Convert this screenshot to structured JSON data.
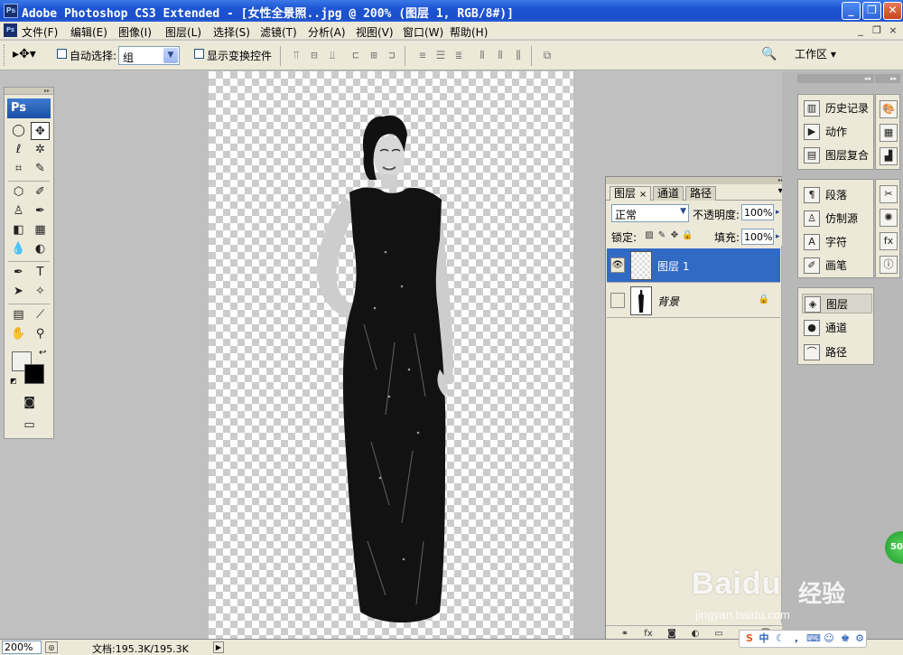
{
  "window": {
    "title": "Adobe Photoshop CS3 Extended - [女性全景照..jpg @ 200% (图层 1, RGB/8#)]",
    "minimize": "_",
    "maximize": "❐",
    "close": "✕"
  },
  "menu": [
    "文件(F)",
    "编辑(E)",
    "图像(I)",
    "图层(L)",
    "选择(S)",
    "滤镜(T)",
    "分析(A)",
    "视图(V)",
    "窗口(W)",
    "帮助(H)"
  ],
  "mdi_controls": [
    "_",
    "❐",
    "×"
  ],
  "options_bar": {
    "auto_select_label": "自动选择:",
    "auto_select_value": "组",
    "show_transform_label": "显示变换控件",
    "workspace_label": "工作区 ▾"
  },
  "toolbox": {
    "logo": "Ps"
  },
  "layers_panel": {
    "tabs": [
      "图层",
      "通道",
      "路径"
    ],
    "tab_close": "×",
    "blend_mode": "正常",
    "opacity_label": "不透明度:",
    "opacity_value": "100%",
    "lock_label": "锁定:",
    "fill_label": "填充:",
    "fill_value": "100%",
    "layers": [
      {
        "name": "图层 1",
        "visible": true,
        "selected": true
      },
      {
        "name": "背景",
        "visible": false,
        "selected": false,
        "locked": true
      }
    ],
    "footer_icons": [
      "link-icon",
      "fx-icon",
      "mask-icon",
      "adjustment-icon",
      "folder-icon",
      "new-layer-icon",
      "trash-icon"
    ]
  },
  "dock": {
    "group1": [
      "历史记录",
      "动作",
      "图层复合"
    ],
    "group2": [
      "段落",
      "仿制源",
      "字符",
      "画笔"
    ],
    "group3": [
      "图层",
      "通道",
      "路径"
    ],
    "active_item": "图层"
  },
  "status_bar": {
    "zoom": "200%",
    "doc_info": "文档:195.3K/195.3K"
  },
  "watermark": {
    "logo": "Baidu",
    "text": "经验",
    "url": "jingyan.baidu.com"
  },
  "tray": {
    "ime_mode": "中"
  },
  "badge": {
    "value": "50"
  },
  "colors": {
    "title_bar": "#1d54d4",
    "selected_layer": "#316ac5",
    "chrome": "#ece9d8"
  }
}
